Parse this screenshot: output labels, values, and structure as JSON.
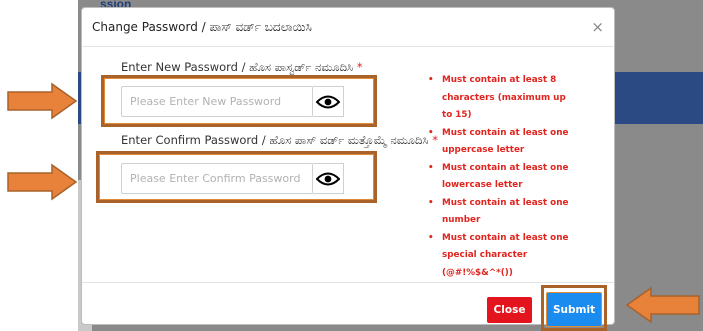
{
  "background": {
    "logo_fragment": "ssion"
  },
  "modal": {
    "title": "Change Password / ಪಾಸ್ ವರ್ಡ್ ಬದಲಾಯಿಸಿ",
    "close_symbol": "×",
    "new_password": {
      "label": "Enter New Password / ಹೊಸ ಪಾಸ್ವರ್ಡ್ ನಮೂದಿಸಿ",
      "required_mark": "*",
      "placeholder": "Please Enter New Password",
      "value": "",
      "toggle_icon": "eye-icon"
    },
    "confirm_password": {
      "label": "Enter Confirm Password / ಹೊಸ ಪಾಸ್ ವರ್ಡ್ ಮತ್ತೊಮ್ಮೆ ನಮೂದಿಸಿ",
      "required_mark": "*",
      "placeholder": "Please Enter Confirm Password",
      "value": "",
      "toggle_icon": "eye-icon"
    },
    "rules": [
      "Must contain at least 8 characters (maximum up to 15)",
      "Must contain at least one uppercase letter",
      "Must contain at least one lowercase letter",
      "Must contain at least one number",
      "Must contain at least one special character (@#!%$&^*())"
    ],
    "buttons": {
      "close": "Close",
      "submit": "Submit"
    }
  },
  "colors": {
    "rule_text": "#e0251f",
    "close_button": "#e3141e",
    "submit_button": "#1a8cf0",
    "highlight_arrow": "#e8823a",
    "highlight_border": "#a8622a"
  }
}
